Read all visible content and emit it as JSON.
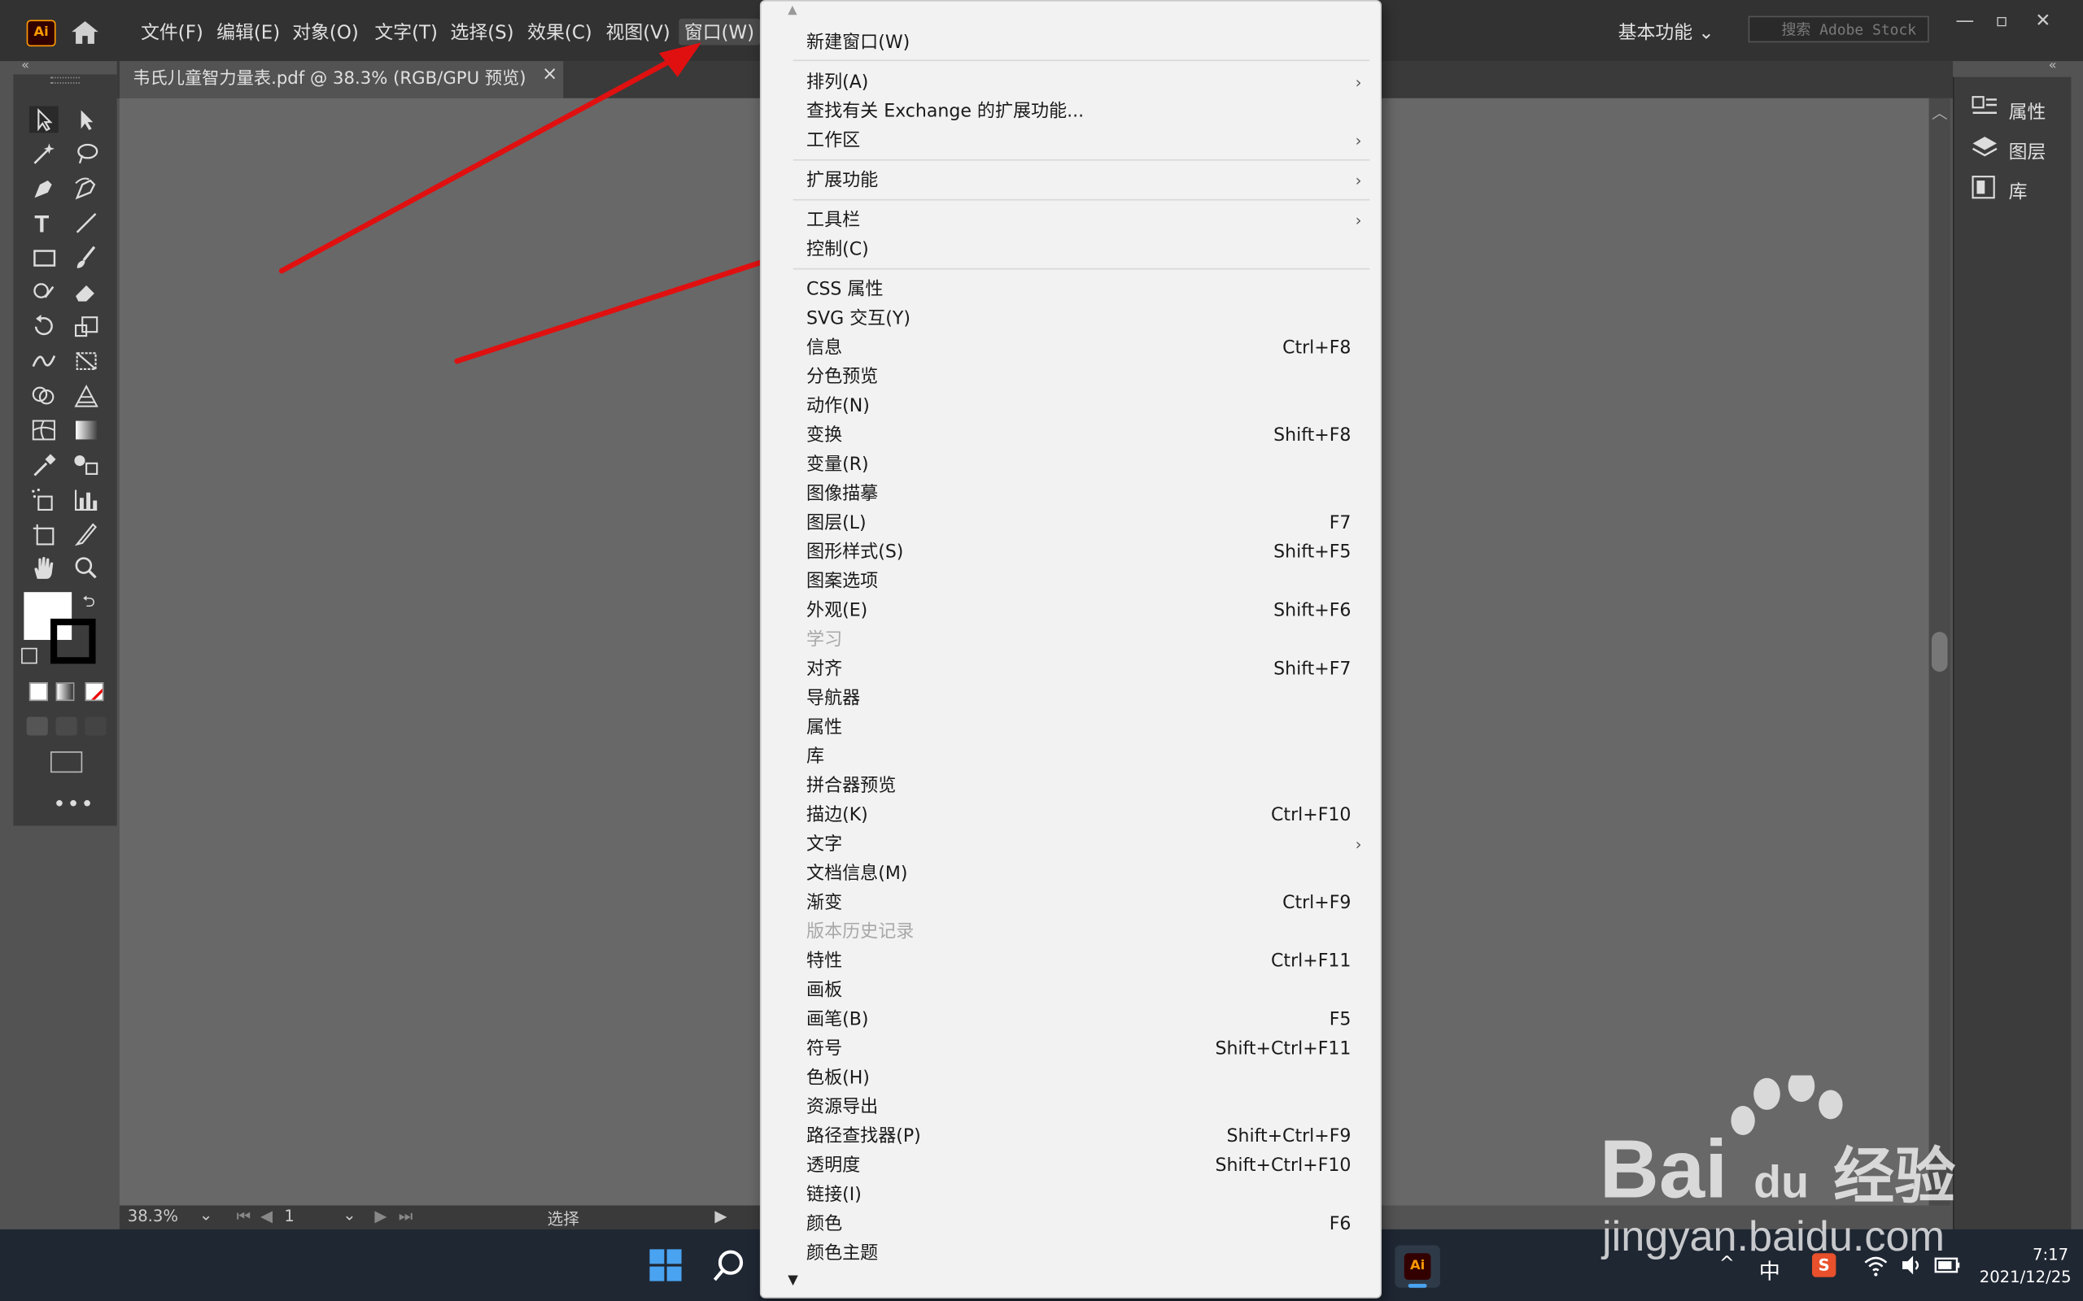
{
  "app": {
    "logo_text": "Ai"
  },
  "menubar": {
    "items": [
      "文件(F)",
      "编辑(E)",
      "对象(O)",
      "文字(T)",
      "选择(S)",
      "效果(C)",
      "视图(V)",
      "窗口(W)"
    ]
  },
  "workspace": {
    "label": "基本功能"
  },
  "search": {
    "placeholder": "搜索 Adobe Stock"
  },
  "document_tab": {
    "title": "韦氏儿童智力量表.pdf @ 38.3% (RGB/GPU 预览)",
    "close": "×"
  },
  "statusbar": {
    "zoom": "38.3%",
    "artboard": "1",
    "tool_status": "选择"
  },
  "right_panel": {
    "items": [
      "属性",
      "图层",
      "库"
    ]
  },
  "window_menu": {
    "items": [
      {
        "label": "新建窗口(W)"
      },
      {
        "label": "排列(A)",
        "submenu": true
      },
      {
        "label": "查找有关 Exchange 的扩展功能..."
      },
      {
        "label": "工作区",
        "submenu": true
      },
      {
        "label": "扩展功能",
        "submenu": true
      },
      {
        "label": "工具栏",
        "submenu": true
      },
      {
        "label": "控制(C)"
      },
      {
        "label": "CSS 属性"
      },
      {
        "label": "SVG 交互(Y)"
      },
      {
        "label": "信息",
        "shortcut": "Ctrl+F8"
      },
      {
        "label": "分色预览"
      },
      {
        "label": "动作(N)"
      },
      {
        "label": "变换",
        "shortcut": "Shift+F8"
      },
      {
        "label": "变量(R)"
      },
      {
        "label": "图像描摹"
      },
      {
        "label": "图层(L)",
        "shortcut": "F7"
      },
      {
        "label": "图形样式(S)",
        "shortcut": "Shift+F5"
      },
      {
        "label": "图案选项"
      },
      {
        "label": "外观(E)",
        "shortcut": "Shift+F6"
      },
      {
        "label": "学习",
        "disabled": true
      },
      {
        "label": "对齐",
        "shortcut": "Shift+F7"
      },
      {
        "label": "导航器"
      },
      {
        "label": "属性"
      },
      {
        "label": "库"
      },
      {
        "label": "拼合器预览"
      },
      {
        "label": "描边(K)",
        "shortcut": "Ctrl+F10"
      },
      {
        "label": "文字",
        "submenu": true
      },
      {
        "label": "文档信息(M)"
      },
      {
        "label": "渐变",
        "shortcut": "Ctrl+F9"
      },
      {
        "label": "版本历史记录",
        "disabled": true
      },
      {
        "label": "特性",
        "shortcut": "Ctrl+F11"
      },
      {
        "label": "画板"
      },
      {
        "label": "画笔(B)",
        "shortcut": "F5"
      },
      {
        "label": "符号",
        "shortcut": "Shift+Ctrl+F11"
      },
      {
        "label": "色板(H)"
      },
      {
        "label": "资源导出"
      },
      {
        "label": "路径查找器(P)",
        "shortcut": "Shift+Ctrl+F9"
      },
      {
        "label": "透明度",
        "shortcut": "Shift+Ctrl+F10"
      },
      {
        "label": "链接(I)"
      },
      {
        "label": "颜色",
        "shortcut": "F6"
      },
      {
        "label": "颜色主题"
      }
    ]
  },
  "taskbar": {
    "ime": "中",
    "time": "7:17",
    "date": "2021/12/25"
  },
  "watermark": {
    "brand": "Bai",
    "brand2": "du",
    "cn": "经验",
    "url": "jingyan.baidu.com"
  },
  "colors": {
    "accent_arrow": "#e01010",
    "menu_bg": "#f2f2f2",
    "app_bg": "#535353"
  }
}
